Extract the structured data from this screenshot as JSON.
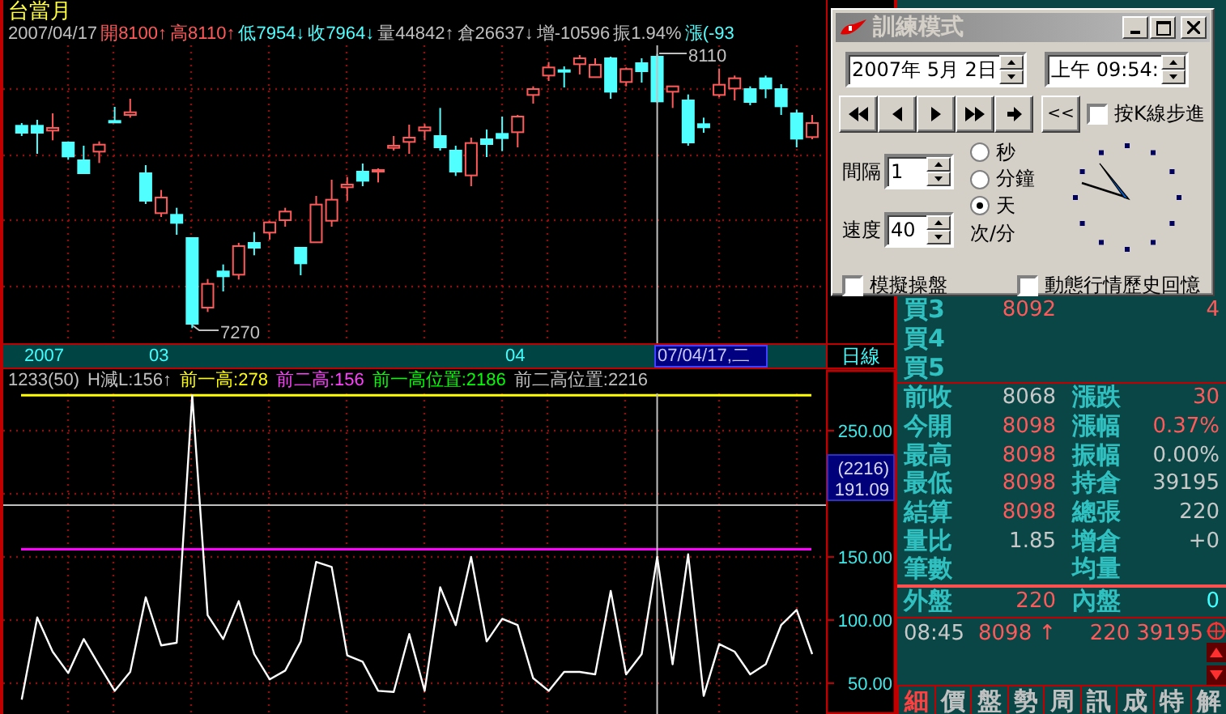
{
  "chart": {
    "title": "台當月",
    "info": [
      {
        "text": "2007/04/17",
        "color": "#c0c0c0"
      },
      {
        "text": "開8100↑",
        "color": "#ff5a5a"
      },
      {
        "text": "高8110↑",
        "color": "#ff5a5a"
      },
      {
        "text": "低7954↓",
        "color": "#50ffff"
      },
      {
        "text": "收7964↓",
        "color": "#50ffff"
      },
      {
        "text": "量44842↑",
        "color": "#c0c0c0"
      },
      {
        "text": "倉26637↓",
        "color": "#c0c0c0"
      },
      {
        "text": "增-10596",
        "color": "#c0c0c0"
      },
      {
        "text": "振1.94%",
        "color": "#c0c0c0"
      },
      {
        "text": "漲(-93",
        "color": "#50ffff"
      }
    ],
    "high_label": "8110",
    "low_label": "7270",
    "date_labels": [
      "2007",
      "03",
      "04"
    ],
    "cursor_date": "07/04/17,二",
    "period": "日線"
  },
  "indicator": {
    "header": [
      {
        "text": "H減L:156↑",
        "color": "#c0c0c0"
      },
      {
        "text": "前一高:278",
        "color": "#ffff00"
      },
      {
        "text": "前二高:156",
        "color": "#ff40ff"
      },
      {
        "text": "前一高位置:2186",
        "color": "#00ff00"
      },
      {
        "text": "前二高位置:2216",
        "color": "#c0c0c0"
      }
    ],
    "cursor_readout": [
      "(2216)",
      "191.09"
    ],
    "chart_data": {
      "type": "line",
      "ylim": [
        25.6,
        279.5
      ],
      "grid": true,
      "yticks": [
        {
          "value": 50,
          "label": "50.00"
        },
        {
          "value": 100,
          "label": "100.00"
        },
        {
          "value": 150,
          "label": "150.00"
        },
        {
          "value": 250,
          "label": "250.00"
        }
      ],
      "series": [
        {
          "name": "1233(50)",
          "color": "#ffffff",
          "values": [
            37,
            102,
            75,
            58,
            85,
            64,
            44,
            59,
            118,
            80,
            82,
            278,
            104,
            85,
            115,
            73,
            53,
            60,
            83,
            146,
            142,
            72,
            67,
            44,
            43,
            89,
            44,
            126,
            96,
            150,
            83,
            101,
            96,
            54,
            44,
            59,
            59,
            57,
            123,
            57,
            73,
            150,
            65,
            152,
            40,
            81,
            75,
            57,
            65,
            96,
            108,
            73
          ]
        }
      ],
      "ref_lines": [
        {
          "axis": "y",
          "value": 278,
          "color": "#ffff00"
        },
        {
          "axis": "y",
          "value": 156,
          "color": "#ff00ff"
        },
        {
          "axis": "y",
          "value": 191.09,
          "color": "#c0c0c0"
        }
      ]
    }
  },
  "quote": {
    "bids": [
      {
        "label": "買3",
        "price": "8092",
        "volume": "4"
      },
      {
        "label": "買4"
      },
      {
        "label": "買5"
      }
    ],
    "stats": [
      {
        "left": {
          "label": "前收",
          "value": "8068",
          "color": "#c8c8c8"
        },
        "right": {
          "label": "漲跌",
          "value": "30",
          "color": "#ff5a5a"
        }
      },
      {
        "left": {
          "label": "今開",
          "value": "8098",
          "color": "#ff5a5a"
        },
        "right": {
          "label": "漲幅",
          "value": "0.37%",
          "color": "#ff5a5a"
        }
      },
      {
        "left": {
          "label": "最高",
          "value": "8098",
          "color": "#ff5a5a"
        },
        "right": {
          "label": "振幅",
          "value": "0.00%",
          "color": "#c8c8c8"
        }
      },
      {
        "left": {
          "label": "最低",
          "value": "8098",
          "color": "#ff5a5a"
        },
        "right": {
          "label": "持倉",
          "value": "39195",
          "color": "#c8c8c8"
        }
      },
      {
        "left": {
          "label": "結算",
          "value": "8098",
          "color": "#ff5a5a"
        },
        "right": {
          "label": "總張",
          "value": "220",
          "color": "#c8c8c8"
        }
      },
      {
        "left": {
          "label": "量比",
          "value": "1.85",
          "color": "#c8c8c8"
        },
        "right": {
          "label": "增倉",
          "value": "+0",
          "color": "#c8c8c8"
        }
      },
      {
        "left": {
          "label": "筆數"
        },
        "right": {
          "label": "均量"
        }
      }
    ],
    "outer": {
      "label": "外盤",
      "value": "220",
      "color": "#ff5a5a"
    },
    "inner": {
      "label": "內盤",
      "value": "0",
      "color": "#40ffff"
    },
    "tick": {
      "time": "08:45",
      "price": "8098",
      "arrow": "↑",
      "volume": "220",
      "open_interest": "39195"
    },
    "tabs": [
      {
        "label": "細",
        "selected": true
      },
      {
        "label": "價",
        "selected": false
      },
      {
        "label": "盤",
        "selected": false
      },
      {
        "label": "勢",
        "selected": false
      },
      {
        "label": "周",
        "selected": false
      },
      {
        "label": "訊",
        "selected": false
      },
      {
        "label": "成",
        "selected": false
      },
      {
        "label": "特",
        "selected": false
      },
      {
        "label": "解",
        "selected": false
      }
    ]
  },
  "dialog": {
    "title": "訓練模式",
    "date": "2007年 5月 2日",
    "time": "上午 09:54:",
    "back_button": "<<",
    "step_checkbox": {
      "label": "按K線步進",
      "checked": false
    },
    "interval": {
      "label": "間隔",
      "value": "1"
    },
    "speed": {
      "label": "速度",
      "value": "40"
    },
    "units": [
      {
        "label": "秒",
        "selected": false
      },
      {
        "label": "分鐘",
        "selected": false
      },
      {
        "label": "天",
        "selected": true
      }
    ],
    "speed_unit": "次/分",
    "options": [
      {
        "label": "模擬操盤",
        "checked": false
      },
      {
        "label": "動態行情歷史回憶",
        "checked": false
      }
    ]
  }
}
